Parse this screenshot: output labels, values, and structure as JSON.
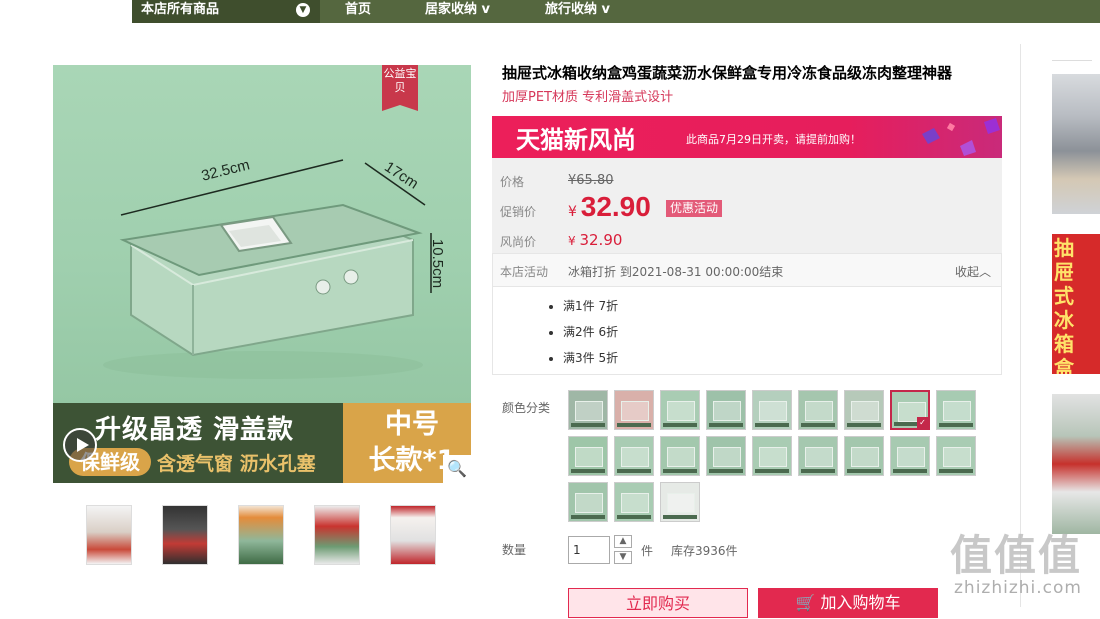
{
  "nav": {
    "all_goods": "本店所有商品",
    "items": [
      "首页",
      "居家收纳 v",
      "旅行收纳 v"
    ]
  },
  "gallery": {
    "badge": "公益宝贝",
    "dims": {
      "length": "32.5cm",
      "width": "17cm",
      "height": "10.5cm"
    },
    "banner_main": "升级晶透 滑盖款",
    "banner_pill": "保鲜级",
    "banner_features": "含透气窗 沥水孔塞",
    "banner_size_1": "中号",
    "banner_size_2": "长款*1",
    "thumbnail_count": 5
  },
  "product": {
    "title": "抽屉式冰箱收纳盒鸡蛋蔬菜沥水保鲜盒专用冷冻食品级冻肉整理神器",
    "subtitle": "加厚PET材质 专利滑盖式设计"
  },
  "promo": {
    "brand": "天猫新风尚",
    "notice": "此商品7月29日开卖，请提前加购！"
  },
  "price": {
    "label_price": "价格",
    "original": "65.80",
    "label_promo": "促销价",
    "promo": "32.90",
    "promo_tag": "优惠活动",
    "label_fs": "风尚价",
    "fs": "32.90",
    "currency": "¥"
  },
  "activity": {
    "label": "本店活动",
    "text": "冰箱打折 到2021-08-31 00:00:00结束",
    "toggle": "收起",
    "rules": [
      "满1件 7折",
      "满2件 6折",
      "满3件 5折"
    ]
  },
  "sku": {
    "label": "颜色分类",
    "count": 21,
    "selected_index": 7
  },
  "quantity": {
    "label": "数量",
    "value": "1",
    "unit": "件",
    "stock": "库存3936件"
  },
  "actions": {
    "buy_now": "立即购买",
    "add_cart": "加入购物车"
  },
  "sidebar": {
    "ad_text": "抽屉式冰箱盒"
  },
  "watermark": {
    "logo": "值值值",
    "url": "zhizhizhi.com"
  },
  "colors": {
    "nav": "#55673f",
    "accent": "#d91e3a",
    "promo": "#ec1f5a"
  }
}
